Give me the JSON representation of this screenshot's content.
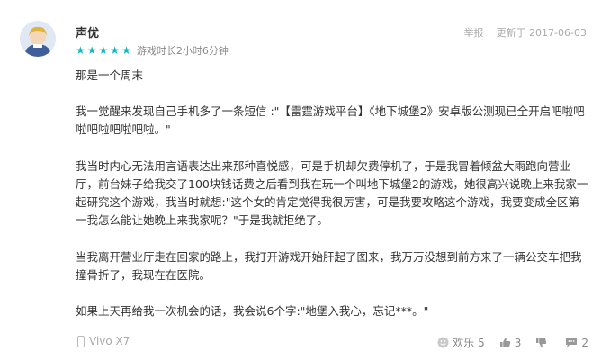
{
  "review": {
    "username": "声优",
    "stars": 5,
    "playtime": "游戏时长2小时6分钟",
    "report_label": "举报",
    "updated": "更新于 2017-06-03",
    "paragraphs": [
      "那是一个周末",
      "我一觉醒来发现自己手机多了一条短信 :\"【雷霆游戏平台】《地下城堡2》安卓版公测现已全开启吧啦吧啦吧啦吧啦吧啦。\"",
      "我当时内心无法用言语表达出来那种喜悦感，可是手机却欠费停机了，于是我冒着倾盆大雨跑向营业厅，前台妹子给我交了100块钱话费之后看到我在玩一个叫地下城堡2的游戏，她很高兴说晚上来我家一起研究这个游戏，我当时就想:\"这个女的肯定觉得我很厉害，可是我要攻略这个游戏，我要变成全区第一我怎么能让她晚上来我家呢？\"于是我就拒绝了。",
      "当我离开营业厅走在回家的路上，我打开游戏开始肝起了图来，我万万没想到前方来了一辆公交车把我撞骨折了，我现在在医院。",
      "如果上天再给我一次机会的话，我会说6个字:\"地堡入我心，忘记***。\""
    ],
    "device": "Vivo X7",
    "funny_label": "欢乐 5",
    "like_count": "3",
    "dislike_count": "",
    "reply_count": "2"
  },
  "colors": {
    "star": "#14b7c1",
    "text": "#333333",
    "muted": "#aaaaaa"
  }
}
